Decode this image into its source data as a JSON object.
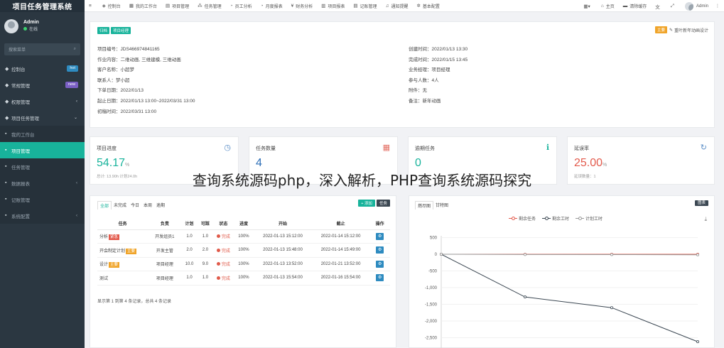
{
  "sidebar": {
    "title": "项目任务管理系统",
    "user": {
      "name": "Admin",
      "status": "在线"
    },
    "search_placeholder": "搜索菜单",
    "items": [
      {
        "label": "控制台",
        "icon": "dashboard-icon",
        "badge": "hot",
        "badge_color": "#2e8bc0",
        "kind": "top"
      },
      {
        "label": "常规管理",
        "icon": "cogs-icon",
        "badge": "new",
        "badge_color": "#7a5fc4",
        "kind": "top"
      },
      {
        "label": "权限管理",
        "icon": "users-icon",
        "arrow": "‹",
        "kind": "top"
      },
      {
        "label": "项目任务管理",
        "icon": "book-icon",
        "arrow": "⌄",
        "kind": "top"
      },
      {
        "label": "我的工作台",
        "icon": "calendar-icon",
        "kind": "sub"
      },
      {
        "label": "项目管理",
        "icon": "book-icon",
        "kind": "active"
      },
      {
        "label": "任务管理",
        "icon": "sitemap-icon",
        "kind": "sub"
      },
      {
        "label": "数据报表",
        "icon": "chart-icon",
        "arrow": "‹",
        "kind": "sub"
      },
      {
        "label": "记账管理",
        "icon": "list-icon",
        "kind": "sub"
      },
      {
        "label": "系统配置",
        "icon": "cogs-icon",
        "arrow": "‹",
        "kind": "sub"
      }
    ]
  },
  "topbar": {
    "nav": [
      {
        "label": "",
        "icon": "menu-toggle-icon",
        "glyph": "≡"
      },
      {
        "label": "控制台",
        "icon": "dashboard-icon",
        "glyph": "◈"
      },
      {
        "label": "我的工作台",
        "icon": "calendar-icon",
        "glyph": "▦"
      },
      {
        "label": "项目管理",
        "icon": "book-icon",
        "glyph": "▤"
      },
      {
        "label": "任务管理",
        "icon": "sitemap-icon",
        "glyph": "⁂"
      },
      {
        "label": "员工分析",
        "icon": "pie-icon",
        "glyph": "◔"
      },
      {
        "label": "月度报表",
        "icon": "pie-icon",
        "glyph": "◔"
      },
      {
        "label": "财务分析",
        "icon": "money-icon",
        "glyph": "¥"
      },
      {
        "label": "项目报表",
        "icon": "table-icon",
        "glyph": "▥"
      },
      {
        "label": "记账管理",
        "icon": "list-icon",
        "glyph": "▤"
      },
      {
        "label": "通知提醒",
        "icon": "bell-icon",
        "glyph": "♫"
      },
      {
        "label": "基本配置",
        "icon": "cog-icon",
        "glyph": "✲"
      }
    ],
    "right": [
      {
        "label": "",
        "icon": "grid-dropdown-icon",
        "glyph": "▦▾"
      },
      {
        "label": "主页",
        "icon": "home-icon",
        "glyph": "⌂"
      },
      {
        "label": "清除缓存",
        "icon": "trash-icon",
        "glyph": "▬"
      },
      {
        "label": "",
        "icon": "language-icon",
        "glyph": "文"
      },
      {
        "label": "",
        "icon": "fullscreen-icon",
        "glyph": "⤢"
      }
    ],
    "admin": "Admin"
  },
  "project": {
    "tags": [
      "归档",
      "项目经理"
    ],
    "remind_tag": "主要",
    "remind_text": "重叶新年动画设计",
    "left": [
      "项目编号：JDS466974841165",
      "作业内容：二维动画, 三维建模, 三维动画",
      "客户名称：小超梦",
      "联系人：梦小超",
      "下单日期：2022/01/13",
      "起止日期：2022/01/13 13:00~2022/03/31 13:00",
      "初稿时间：2022/03/31 13:00"
    ],
    "right": [
      "创建时间：2022/01/13 13:30",
      "完成时间：2022/01/15 13:45",
      "业务经理：项目经理",
      "参与人数：4人",
      "附件：无",
      "备注：新年动画"
    ]
  },
  "stats": [
    {
      "title": "项目进度",
      "value": "54.17",
      "unit": "%",
      "note": "总计: 13.90h 计划24.0h",
      "color": "#18b39b",
      "icon": "clock-icon",
      "glyph": "◷",
      "icon_color": "#5b8ec7"
    },
    {
      "title": "任务数量",
      "value": "4",
      "unit": "",
      "note": "",
      "color": "#2e6fb7",
      "icon": "calendar-icon",
      "glyph": "▦",
      "icon_color": "#e36f64"
    },
    {
      "title": "逾期任务",
      "value": "0",
      "unit": "",
      "note": "",
      "color": "#18b39b",
      "icon": "info-icon",
      "glyph": "ℹ",
      "icon_color": "#18b39b"
    },
    {
      "title": "延误率",
      "value": "25.00",
      "unit": "%",
      "note": "延误数量：1",
      "color": "#e35b4d",
      "icon": "refresh-icon",
      "glyph": "↻",
      "icon_color": "#5b8ec7"
    }
  ],
  "tasks": {
    "tabs": [
      "全部",
      "未完成",
      "今日",
      "本周",
      "逾期"
    ],
    "add_label": "+ 添加",
    "task_label": "任务",
    "headers": [
      "任务",
      "负责",
      "计划",
      "可踩",
      "状态",
      "进度",
      "开始",
      "截止",
      "操作"
    ],
    "rows": [
      {
        "name": "分析",
        "tag": "紧急",
        "tag_color": "#e35b4d",
        "owner": "开发组员1",
        "plan": "1.0",
        "actual": "1.0",
        "status": "完成",
        "progress": "100%",
        "start": "2022-01-13 15:12:00",
        "end": "2022-01-14 15:12:00"
      },
      {
        "name": "开会制定计划",
        "tag": "主要",
        "tag_color": "#f0a429",
        "owner": "开发主管",
        "plan": "2.0",
        "actual": "2.0",
        "status": "完成",
        "progress": "100%",
        "start": "2022-01-13 15:48:00",
        "end": "2022-01-14 15:49:00"
      },
      {
        "name": "设计",
        "tag": "主要",
        "tag_color": "#f0a429",
        "owner": "项目经理",
        "plan": "10.0",
        "actual": "9.0",
        "status": "完成",
        "progress": "100%",
        "start": "2022-01-13 13:52:00",
        "end": "2022-01-21 13:52:00"
      },
      {
        "name": "测试",
        "tag": "",
        "tag_color": "",
        "owner": "项目经理",
        "plan": "1.0",
        "actual": "1.0",
        "status": "完成",
        "progress": "100%",
        "start": "2022-01-13 15:54:00",
        "end": "2022-01-16 15:54:00"
      }
    ],
    "footer": "显示第 1 到第 4 条记录，总共 4 条记录"
  },
  "chart_panel": {
    "tabs": [
      "燃尽图",
      "甘特图"
    ],
    "right_label": "图表"
  },
  "chart_data": {
    "type": "line",
    "series": [
      {
        "name": "剩余任务",
        "color": "#e35b4d",
        "values": [
          0,
          0,
          0,
          0
        ]
      },
      {
        "name": "剩余工时",
        "color": "#3b4752",
        "values": [
          0,
          -1280,
          -1600,
          -2620
        ]
      },
      {
        "name": "计划工时",
        "color": "#999999",
        "values": [
          0,
          -8,
          -10,
          -15
        ]
      }
    ],
    "ylim": [
      -2600,
      500
    ],
    "yticks": [
      500,
      0,
      -500,
      -1000,
      -1500,
      -2000,
      -2500
    ],
    "ytick_labels": [
      "500",
      "0",
      "-500",
      "-1,000",
      "-1,500",
      "-2,000",
      "-2,500"
    ],
    "grid": true,
    "legend": "top"
  },
  "overlay_text": "查询系统源码php，深入解析，PHP查询系统源码探究"
}
